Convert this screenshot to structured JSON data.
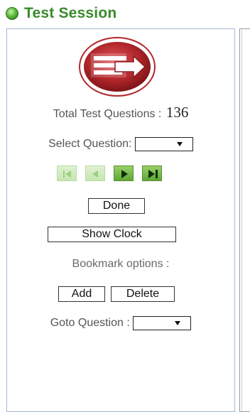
{
  "header": {
    "title": "Test Session"
  },
  "panel": {
    "total_label": "Total Test Questions :",
    "total_value": "136",
    "select_label": "Select Question:",
    "select_value": "",
    "done_label": "Done",
    "show_clock_label": "Show Clock",
    "bookmark_label": "Bookmark options :",
    "add_label": "Add",
    "delete_label": "Delete",
    "goto_label": "Goto Question :",
    "goto_value": ""
  },
  "nav": [
    {
      "name": "first-question-button",
      "icon": "skip-first-icon",
      "enabled": false
    },
    {
      "name": "previous-question-button",
      "icon": "previous-icon",
      "enabled": false
    },
    {
      "name": "next-question-button",
      "icon": "next-icon",
      "enabled": true
    },
    {
      "name": "last-question-button",
      "icon": "skip-last-icon",
      "enabled": true
    }
  ],
  "colors": {
    "title": "#3a8a2a",
    "panel_border": "#9fbad8",
    "logo_red": "#b3282d"
  }
}
